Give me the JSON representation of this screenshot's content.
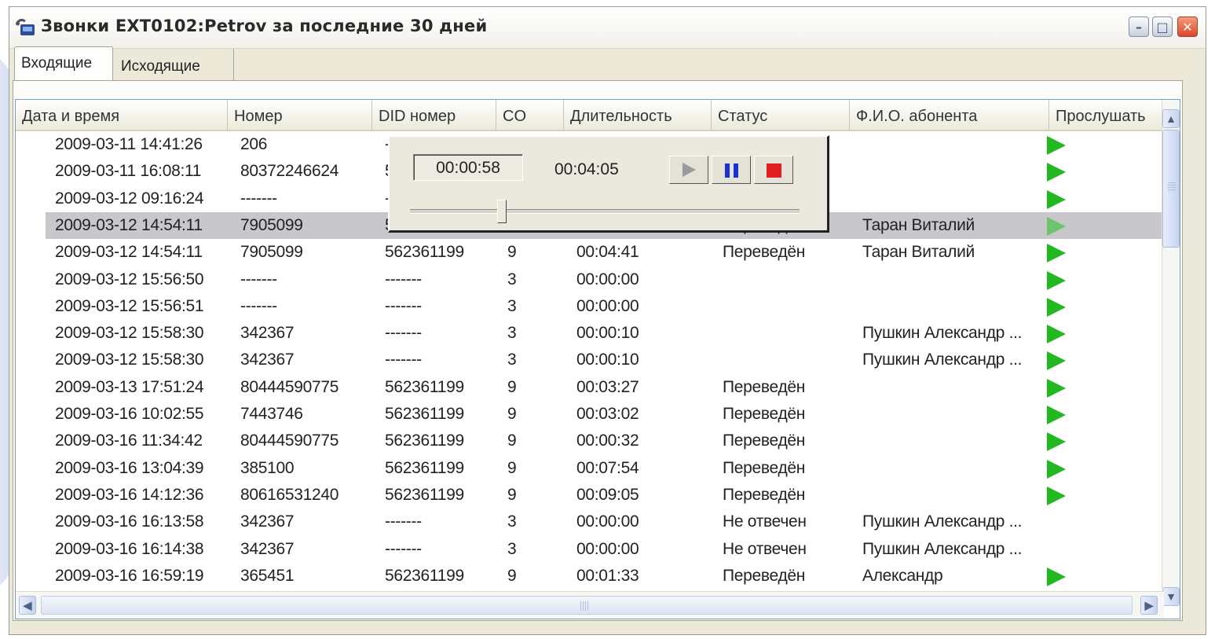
{
  "window": {
    "title": "Звонки EXT0102:Petrov за последние 30 дней",
    "minimize_glyph": "–",
    "maximize_glyph": "□",
    "close_glyph": "✕"
  },
  "tabs": [
    {
      "label": "Входящие",
      "active": true
    },
    {
      "label": "Исходящие",
      "active": false
    }
  ],
  "columns": [
    "Дата и время",
    "Номер",
    "DID номер",
    "CO",
    "Длительность",
    "Статус",
    "Ф.И.О. абонента",
    "Прослушать"
  ],
  "rows": [
    {
      "datetime": "2009-03-11 14:41:26",
      "number": "206",
      "did": "-",
      "co": "",
      "duration": "",
      "status": "",
      "name": "",
      "play": true
    },
    {
      "datetime": "2009-03-11 16:08:11",
      "number": "80372246624",
      "did": "5",
      "co": "",
      "duration": "",
      "status": "",
      "name": "",
      "play": true
    },
    {
      "datetime": "2009-03-12 09:16:24",
      "number": "-------",
      "did": "-",
      "co": "",
      "duration": "",
      "status": "",
      "name": "",
      "play": true
    },
    {
      "datetime": "2009-03-12 14:54:11",
      "number": "7905099",
      "did": "562361199",
      "co": "9",
      "duration": "00:04:39",
      "status": "Переведён",
      "name": "Таран Виталий",
      "play": true,
      "selected": true
    },
    {
      "datetime": "2009-03-12 14:54:11",
      "number": "7905099",
      "did": "562361199",
      "co": "9",
      "duration": "00:04:41",
      "status": "Переведён",
      "name": "Таран Виталий",
      "play": true
    },
    {
      "datetime": "2009-03-12 15:56:50",
      "number": "-------",
      "did": "-------",
      "co": "3",
      "duration": "00:00:00",
      "status": "",
      "name": "",
      "play": true
    },
    {
      "datetime": "2009-03-12 15:56:51",
      "number": "-------",
      "did": "-------",
      "co": "3",
      "duration": "00:00:00",
      "status": "",
      "name": "",
      "play": true
    },
    {
      "datetime": "2009-03-12 15:58:30",
      "number": "342367",
      "did": "-------",
      "co": "3",
      "duration": "00:00:10",
      "status": "",
      "name": "Пушкин Александр ...",
      "play": true
    },
    {
      "datetime": "2009-03-12 15:58:30",
      "number": "342367",
      "did": "-------",
      "co": "3",
      "duration": "00:00:10",
      "status": "",
      "name": "Пушкин Александр ...",
      "play": true
    },
    {
      "datetime": "2009-03-13 17:51:24",
      "number": "80444590775",
      "did": "562361199",
      "co": "9",
      "duration": "00:03:27",
      "status": "Переведён",
      "name": "",
      "play": true
    },
    {
      "datetime": "2009-03-16 10:02:55",
      "number": "7443746",
      "did": "562361199",
      "co": "9",
      "duration": "00:03:02",
      "status": "Переведён",
      "name": "",
      "play": true
    },
    {
      "datetime": "2009-03-16 11:34:42",
      "number": "80444590775",
      "did": "562361199",
      "co": "9",
      "duration": "00:00:32",
      "status": "Переведён",
      "name": "",
      "play": true
    },
    {
      "datetime": "2009-03-16 13:04:39",
      "number": "385100",
      "did": "562361199",
      "co": "9",
      "duration": "00:07:54",
      "status": "Переведён",
      "name": "",
      "play": true
    },
    {
      "datetime": "2009-03-16 14:12:36",
      "number": "80616531240",
      "did": "562361199",
      "co": "9",
      "duration": "00:09:05",
      "status": "Переведён",
      "name": "",
      "play": true
    },
    {
      "datetime": "2009-03-16 16:13:58",
      "number": "342367",
      "did": "-------",
      "co": "3",
      "duration": "00:00:00",
      "status": "Не отвечен",
      "name": "Пушкин Александр ...",
      "play": false
    },
    {
      "datetime": "2009-03-16 16:14:38",
      "number": "342367",
      "did": "-------",
      "co": "3",
      "duration": "00:00:00",
      "status": "Не отвечен",
      "name": "Пушкин Александр ...",
      "play": false
    },
    {
      "datetime": "2009-03-16 16:59:19",
      "number": "365451",
      "did": "562361199",
      "co": "9",
      "duration": "00:01:33",
      "status": "Переведён",
      "name": "Александр",
      "play": true
    }
  ],
  "player": {
    "position": "00:00:58",
    "total": "00:04:05",
    "progress_fraction": 0.236
  },
  "scroll": {
    "up": "▲",
    "down": "▼",
    "left": "◀",
    "right": "▶"
  },
  "colors": {
    "play_green": "#22b822",
    "selection": "#c7c7cc",
    "pause_blue": "#1c2fd0",
    "stop_red": "#e02020"
  }
}
